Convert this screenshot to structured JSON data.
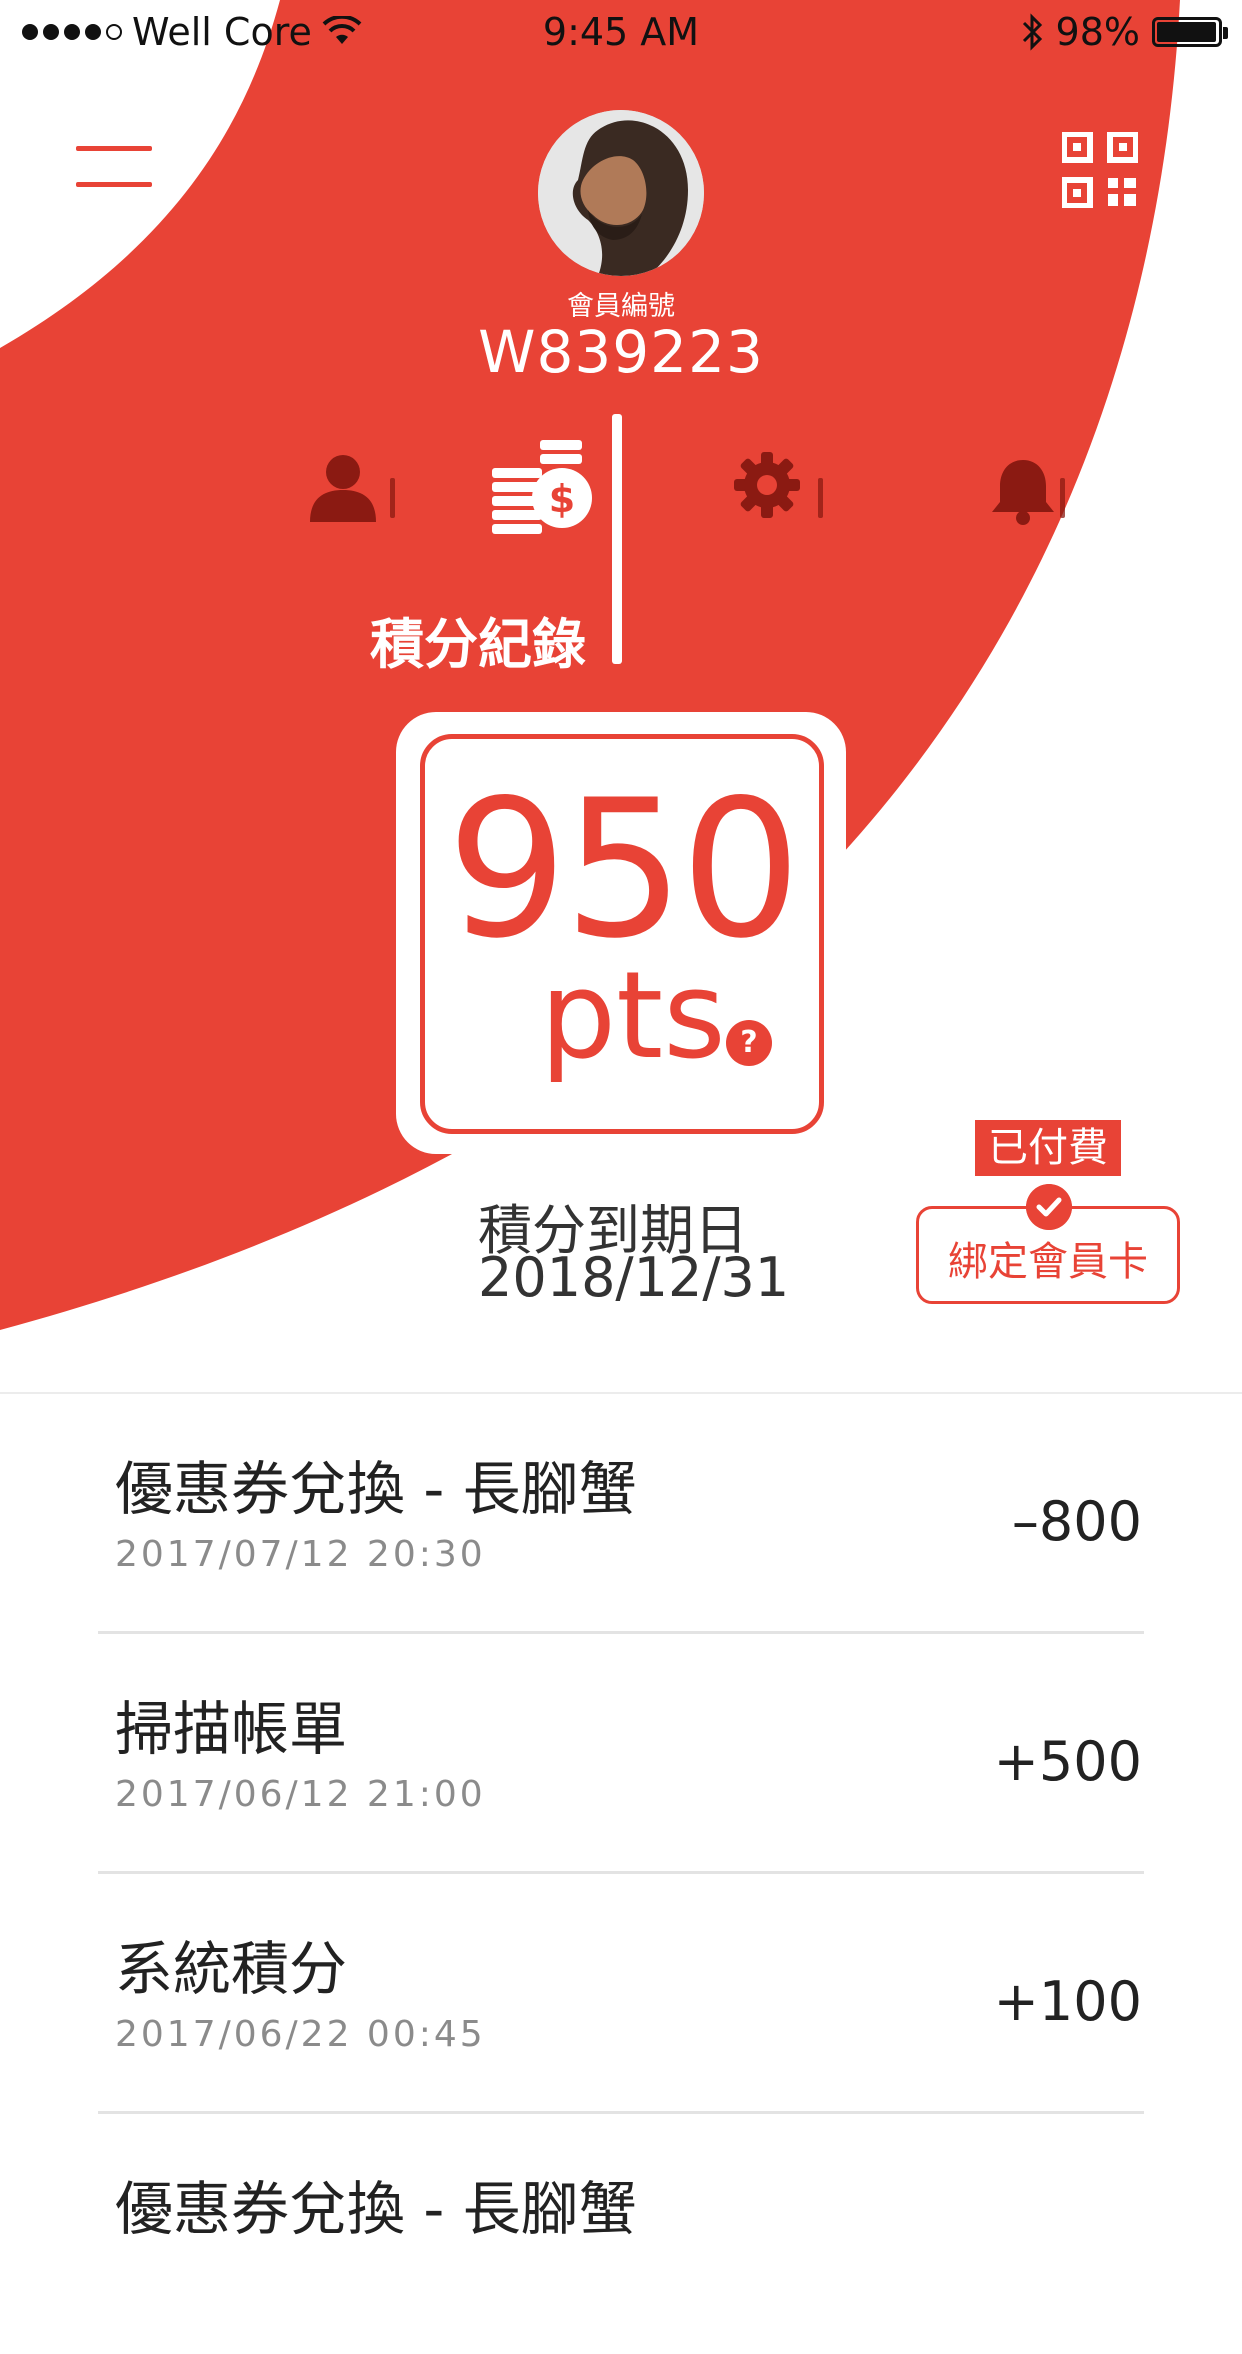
{
  "status_bar": {
    "carrier": "Well Core",
    "time": "9:45 AM",
    "battery": "98%"
  },
  "header": {
    "member_label": "會員編號",
    "member_id": "W839223"
  },
  "tabs": {
    "icons": [
      "profile-icon",
      "coins-icon",
      "gear-icon",
      "bell-icon"
    ],
    "active_label": "積分紀錄"
  },
  "points": {
    "value": "950",
    "unit": "pts",
    "help": "?"
  },
  "expiry": {
    "label": "積分到期日",
    "date": "2018/12/31"
  },
  "card": {
    "paid_badge": "已付費",
    "bind_label": "綁定會員卡"
  },
  "transactions": [
    {
      "title": "優惠券兌換 - 長腳蟹",
      "date": "2017/07/12 20:30",
      "amount": "–800"
    },
    {
      "title": "掃描帳單",
      "date": "2017/06/12 21:00",
      "amount": "+500"
    },
    {
      "title": "系統積分",
      "date": "2017/06/22 00:45",
      "amount": "+100"
    },
    {
      "title": "優惠券兌換 - 長腳蟹",
      "date": "",
      "amount": ""
    }
  ],
  "colors": {
    "accent": "#e84336",
    "dark_icon": "#8b1a12"
  }
}
